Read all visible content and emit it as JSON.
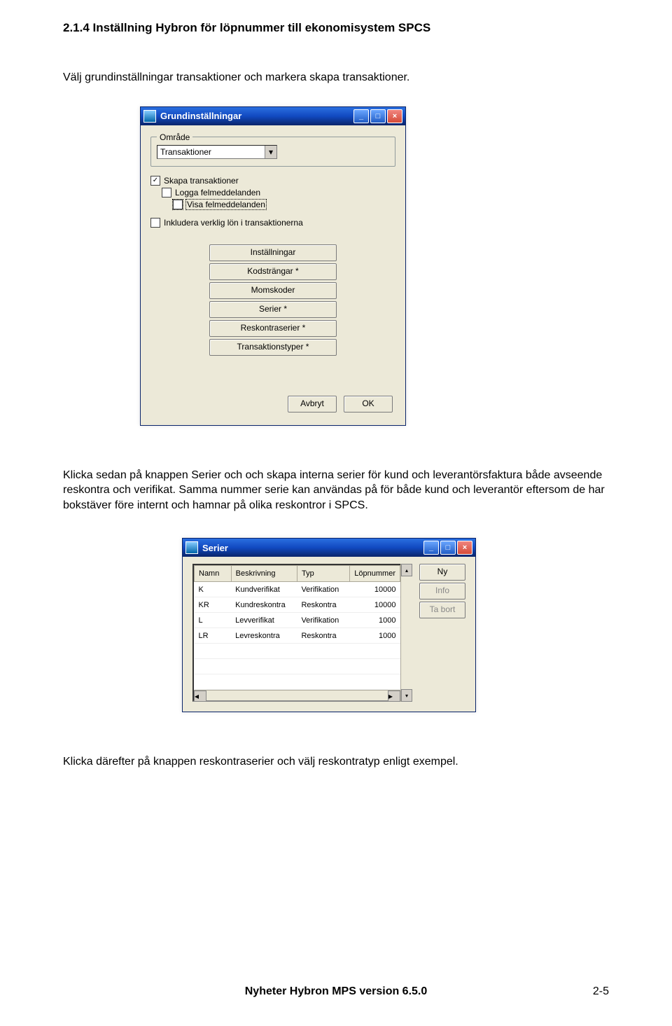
{
  "section_title": "2.1.4  Inställning Hybron för löpnummer till ekonomisystem SPCS",
  "para1": "Välj grundinställningar transaktioner och markera skapa transaktioner.",
  "para2": "Klicka sedan på knappen Serier och och skapa interna serier för kund och leverantörsfaktura både avseende reskontra och verifikat. Samma nummer serie kan användas på för både kund och leverantör eftersom de har  bokstäver före internt och hamnar på olika reskontror i SPCS.",
  "para3": "Klicka därefter på knappen reskontraserier och välj reskontratyp enligt exempel.",
  "footer_text": "Nyheter Hybron MPS version 6.5.0",
  "page_number": "2-5",
  "window1": {
    "title": "Grundinställningar",
    "area_legend": "Område",
    "combo_value": "Transaktioner",
    "chk1": "Skapa transaktioner",
    "chk2": "Logga felmeddelanden",
    "chk3": "Visa felmeddelanden",
    "chk4": "Inkludera verklig lön i transaktionerna",
    "btns": [
      "Inställningar",
      "Kodsträngar *",
      "Momskoder",
      "Serier *",
      "Reskontraserier *",
      "Transaktionstyper *"
    ],
    "avbryt": "Avbryt",
    "ok": "OK"
  },
  "window2": {
    "title": "Serier",
    "headers": [
      "Namn",
      "Beskrivning",
      "Typ",
      "Löpnummer"
    ],
    "rows": [
      {
        "n": "K",
        "b": "Kundverifikat",
        "t": "Verifikation",
        "l": "10000"
      },
      {
        "n": "KR",
        "b": "Kundreskontra",
        "t": "Reskontra",
        "l": "10000"
      },
      {
        "n": "L",
        "b": "Levverifikat",
        "t": "Verifikation",
        "l": "1000"
      },
      {
        "n": "LR",
        "b": "Levreskontra",
        "t": "Reskontra",
        "l": "1000"
      }
    ],
    "ny": "Ny",
    "info": "Info",
    "tabort": "Ta bort"
  }
}
